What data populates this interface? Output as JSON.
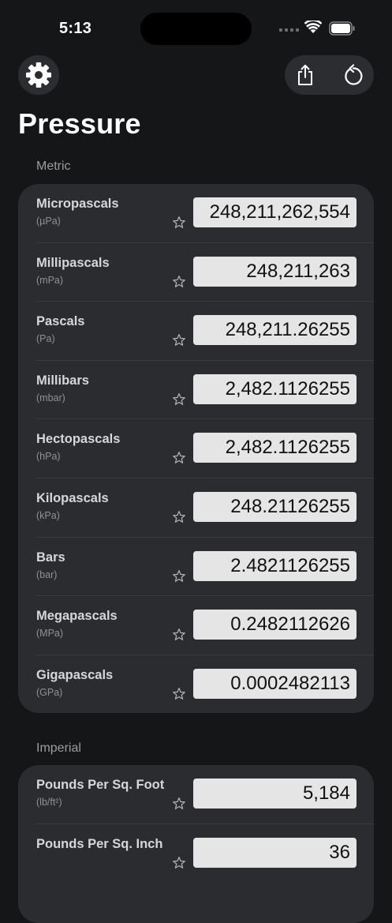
{
  "status": {
    "time": "5:13"
  },
  "title": "Pressure",
  "sections": [
    {
      "label": "Metric",
      "rows": [
        {
          "name": "Micropascals",
          "unit": "(µPa)",
          "value": "248,211,262,554"
        },
        {
          "name": "Millipascals",
          "unit": "(mPa)",
          "value": "248,211,263"
        },
        {
          "name": "Pascals",
          "unit": "(Pa)",
          "value": "248,211.26255"
        },
        {
          "name": "Millibars",
          "unit": "(mbar)",
          "value": "2,482.1126255"
        },
        {
          "name": "Hectopascals",
          "unit": "(hPa)",
          "value": "2,482.1126255"
        },
        {
          "name": "Kilopascals",
          "unit": "(kPa)",
          "value": "248.21126255"
        },
        {
          "name": "Bars",
          "unit": "(bar)",
          "value": "2.4821126255"
        },
        {
          "name": "Megapascals",
          "unit": "(MPa)",
          "value": "0.2482112626"
        },
        {
          "name": "Gigapascals",
          "unit": "(GPa)",
          "value": "0.0002482113"
        }
      ]
    },
    {
      "label": "Imperial",
      "rows": [
        {
          "name": "Pounds Per Sq. Foot",
          "unit": "(lb/ft²)",
          "value": "5,184"
        },
        {
          "name": "Pounds Per Sq. Inch",
          "unit": "",
          "value": "36"
        }
      ]
    }
  ],
  "icons": {
    "settings": "gear-icon",
    "share": "share-icon",
    "reset": "reset-icon",
    "favorite": "star-outline-icon"
  }
}
